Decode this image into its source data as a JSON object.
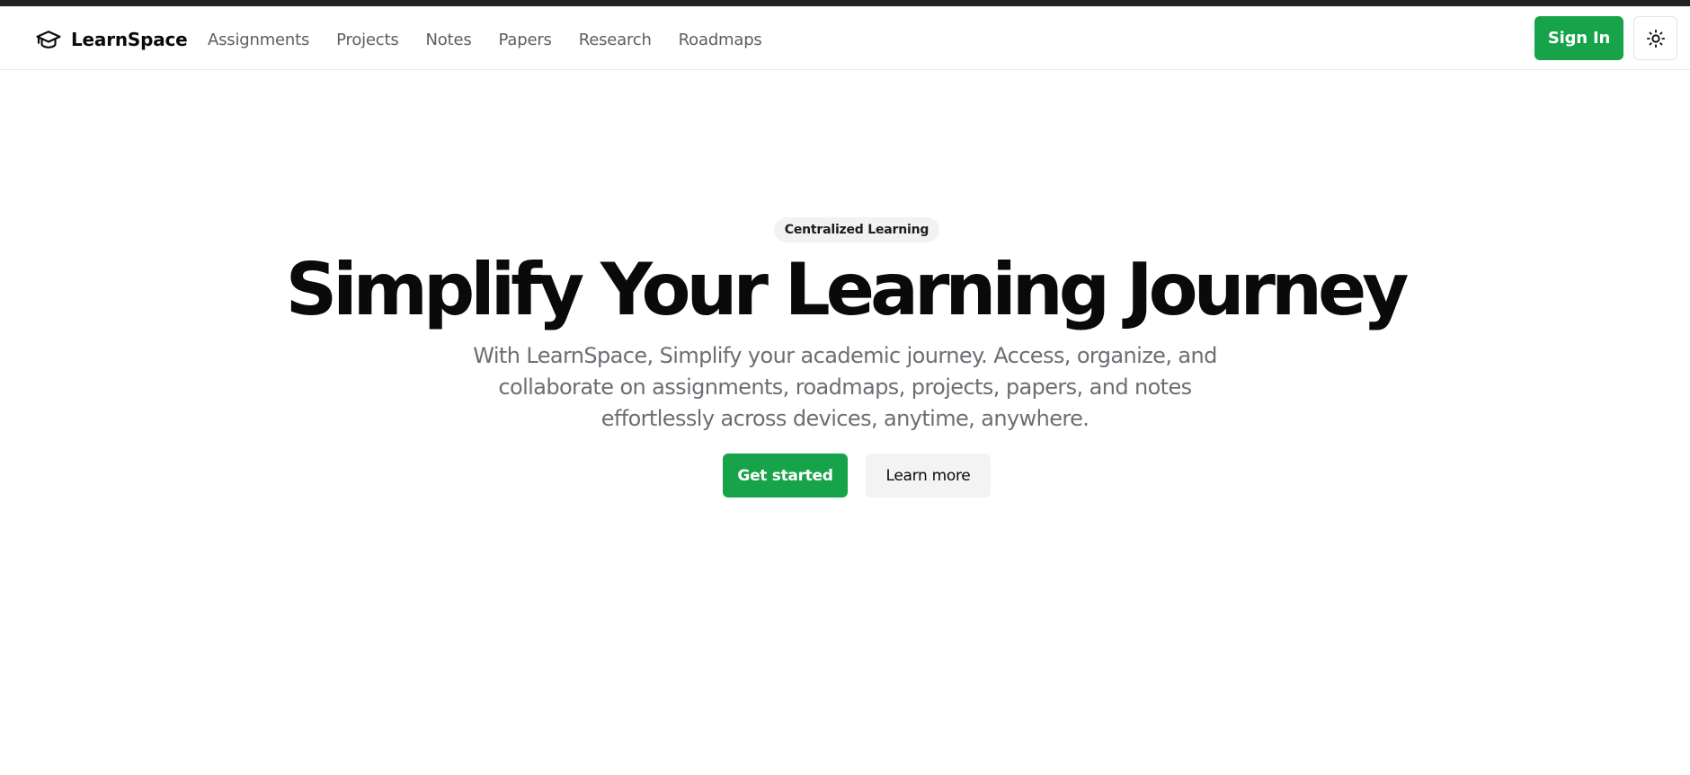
{
  "brand": {
    "name": "LearnSpace",
    "icon": "graduation-cap-icon"
  },
  "nav": {
    "links": [
      "Assignments",
      "Projects",
      "Notes",
      "Papers",
      "Research",
      "Roadmaps"
    ]
  },
  "header": {
    "sign_in_label": "Sign In",
    "theme_icon": "sun-icon"
  },
  "hero": {
    "badge": "Centralized Learning",
    "title": "Simplify Your Learning Journey",
    "subtitle": "With LearnSpace, Simplify your academic journey. Access, organize, and collaborate on assignments, roadmaps, projects, papers, and notes effortlessly across devices, anytime, anywhere.",
    "primary_cta": "Get started",
    "secondary_cta": "Learn more"
  },
  "colors": {
    "accent": "#17a34a",
    "top_strip": "#1f2326",
    "muted_text": "#6b6e73",
    "nav_text": "#5b5e63"
  }
}
